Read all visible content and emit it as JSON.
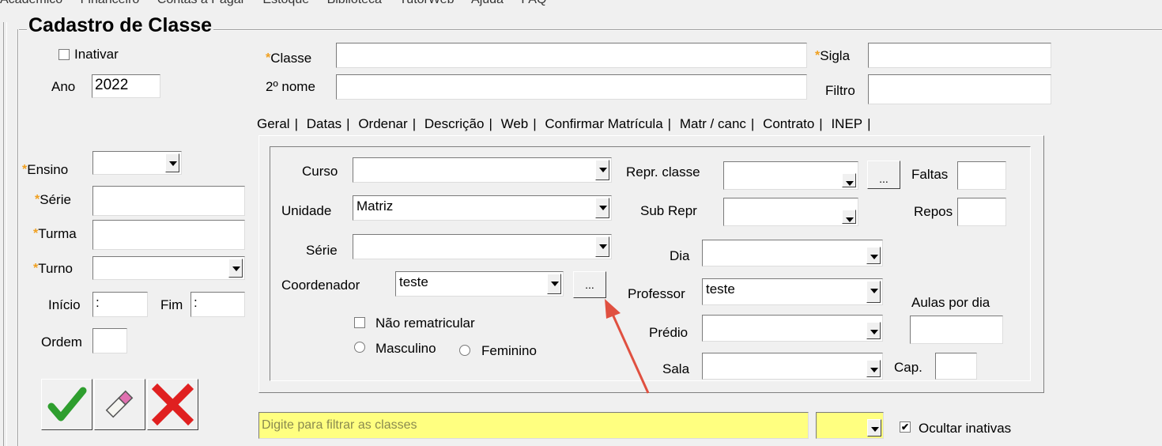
{
  "menu": [
    "Acadêmico",
    "Financeiro",
    "Contas a Pagar",
    "Estoque",
    "Biblioteca",
    "TutorWeb",
    "Ajuda",
    "FAQ"
  ],
  "form_title": "Cadastro de Classe",
  "left": {
    "inativar_label": "Inativar",
    "ano_label": "Ano",
    "ano_value": "2022",
    "ensino_label": "Ensino",
    "serie_label": "Série",
    "turma_label": "Turma",
    "turno_label": "Turno",
    "inicio_label": "Início",
    "inicio_value": ":",
    "fim_label": "Fim",
    "fim_value": ":",
    "ordem_label": "Ordem"
  },
  "top": {
    "classe_label": "Classe",
    "sigla_label": "Sigla",
    "segundo_nome_label": "2º nome",
    "filtro_label": "Filtro"
  },
  "tabs": [
    "Geral",
    "Datas",
    "Ordenar",
    "Descrição",
    "Web",
    "Confirmar Matrícula",
    "Matr / canc",
    "Contrato",
    "INEP"
  ],
  "geral": {
    "curso_label": "Curso",
    "unidade_label": "Unidade",
    "unidade_value": "Matriz",
    "serie_label": "Série",
    "coordenador_label": "Coordenador",
    "coordenador_value": "teste",
    "ellipsis": "...",
    "nao_rematricular_label": "Não rematricular",
    "masculino_label": "Masculino",
    "feminino_label": "Feminino",
    "repr_classe_label": "Repr. classe",
    "faltas_label": "Faltas",
    "sub_repr_label": "Sub Repr",
    "repos_label": "Repos",
    "dia_label": "Dia",
    "professor_label": "Professor",
    "professor_value": "teste",
    "aulas_por_dia_label": "Aulas por dia",
    "predio_label": "Prédio",
    "sala_label": "Sala",
    "cap_label": "Cap."
  },
  "filter": {
    "placeholder": "Digite para filtrar as classes",
    "ocultar_label": "Ocultar inativas",
    "ocultar_checked": "✔"
  },
  "colors": {
    "star": "#f0a020",
    "filter_bg": "#ffff80",
    "confirm_green": "#2e9e2e",
    "cancel_red": "#e02020",
    "annotation_arrow": "#e05040"
  },
  "icons": [
    "check-icon",
    "eraser-icon",
    "x-icon"
  ]
}
